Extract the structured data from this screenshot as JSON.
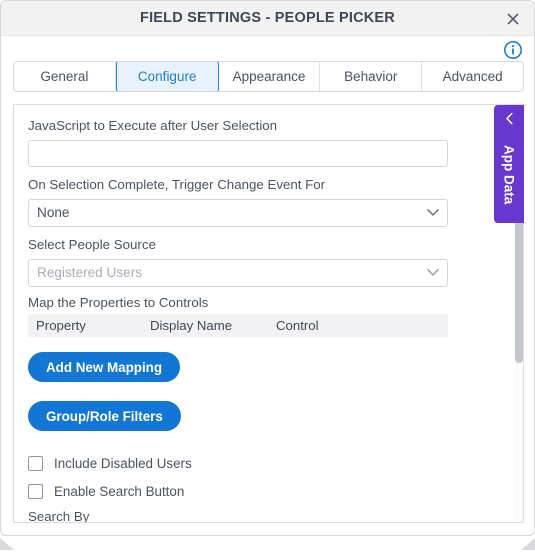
{
  "dialog": {
    "title": "FIELD SETTINGS - PEOPLE PICKER",
    "close_label": "×",
    "close_icon": "close-icon",
    "info_icon": "info-circle-icon"
  },
  "tabs": [
    {
      "label": "General",
      "active": false
    },
    {
      "label": "Configure",
      "active": true
    },
    {
      "label": "Appearance",
      "active": false
    },
    {
      "label": "Behavior",
      "active": false
    },
    {
      "label": "Advanced",
      "active": false
    }
  ],
  "form": {
    "javascript": {
      "label": "JavaScript to Execute after User Selection",
      "value": "",
      "placeholder": ""
    },
    "trigger_change": {
      "label": "On Selection Complete, Trigger Change Event For",
      "value": "None",
      "chevron_icon": "chevron-down-icon"
    },
    "people_source": {
      "label": "Select People Source",
      "value": "Registered Users",
      "disabled": true,
      "chevron_icon": "chevron-down-icon"
    },
    "mapping": {
      "label": "Map the Properties to Controls",
      "columns": [
        "Property",
        "Display Name",
        "Control"
      ],
      "rows": []
    },
    "buttons": {
      "add_new_mapping": "Add New Mapping",
      "group_role_filters": "Group/Role Filters"
    },
    "checkboxes": [
      {
        "label": "Include Disabled Users",
        "checked": false
      },
      {
        "label": "Enable Search Button",
        "checked": false
      }
    ],
    "search_by": {
      "label": "Search By"
    }
  },
  "side_panel": {
    "label": "App Data",
    "chevron_icon": "chevron-left-icon"
  },
  "colors": {
    "accent_blue": "#1277d4",
    "tab_active_border": "#2a83d6",
    "tab_active_bg": "#e7f2fd",
    "app_data_purple": "#6837cf",
    "title_bar_bg": "#f2f2f2",
    "text": "#4a5360"
  }
}
